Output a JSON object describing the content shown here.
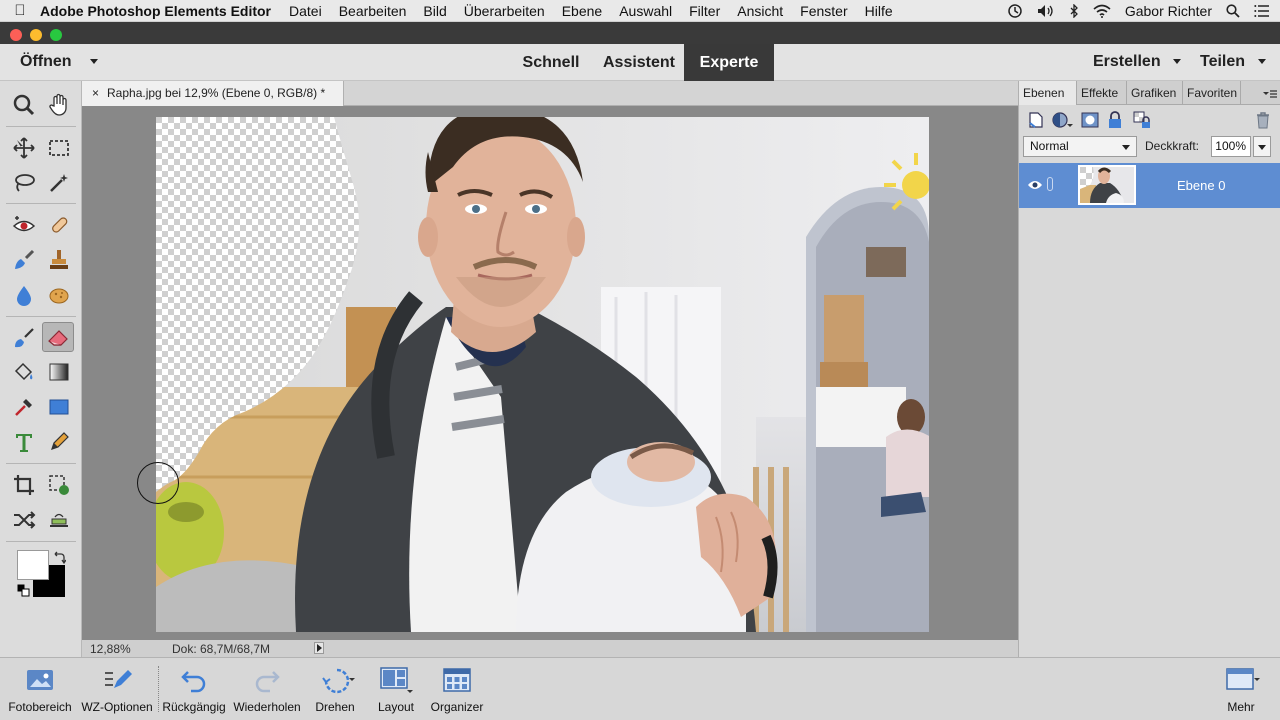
{
  "menubar": {
    "app_name": "Adobe Photoshop Elements Editor",
    "menus": [
      "Datei",
      "Bearbeiten",
      "Bild",
      "Überarbeiten",
      "Ebene",
      "Auswahl",
      "Filter",
      "Ansicht",
      "Fenster",
      "Hilfe"
    ],
    "user": "Gabor Richter"
  },
  "topbar": {
    "open_label": "Öffnen",
    "modes": [
      "Schnell",
      "Assistent",
      "Experte"
    ],
    "active_mode": "Experte",
    "create_label": "Erstellen",
    "share_label": "Teilen"
  },
  "document": {
    "tab_close": "×",
    "tab_title": "Rapha.jpg bei 12,9% (Ebene 0, RGB/8) *",
    "zoom": "12,88%",
    "doc_size": "Dok: 68,7M/68,7M"
  },
  "layers_panel": {
    "tabs": [
      "Ebenen",
      "Effekte",
      "Grafiken",
      "Favoriten"
    ],
    "active_tab": "Ebenen",
    "blend_mode": "Normal",
    "opacity_label": "Deckkraft:",
    "opacity_value": "100%",
    "layers": [
      {
        "name": "Ebene 0",
        "selected": true
      }
    ]
  },
  "taskbar": {
    "items": [
      {
        "label": "Fotobereich",
        "icon": "photo-bin-icon"
      },
      {
        "label": "WZ-Optionen",
        "icon": "tool-options-icon"
      },
      {
        "label": "Rückgängig",
        "icon": "undo-icon"
      },
      {
        "label": "Wiederholen",
        "icon": "redo-icon"
      },
      {
        "label": "Drehen",
        "icon": "rotate-icon"
      },
      {
        "label": "Layout",
        "icon": "layout-icon"
      },
      {
        "label": "Organizer",
        "icon": "organizer-icon"
      },
      {
        "label": "Mehr",
        "icon": "more-icon"
      }
    ]
  },
  "colors": {
    "accent_active_mode": "#393939",
    "layer_selected": "#5e8dd2",
    "eraser_tool_active": "#e76b7c"
  }
}
